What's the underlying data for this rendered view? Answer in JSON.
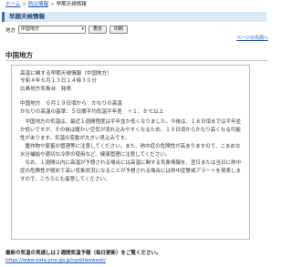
{
  "breadcrumb": {
    "home": "ホーム",
    "sep1": ">",
    "disaster": "防災情報",
    "sep2": ">",
    "current": "早期天候情報"
  },
  "page_title": "早期天候情報",
  "region": {
    "label": "地方",
    "selected": "中国地方",
    "show_button": "表示",
    "print_button": "印刷"
  },
  "top_link": "ページの先頭へ",
  "section_title": "中国地方",
  "report": {
    "heading": "高温に関する早期天候情報（中国地方）",
    "datetime": "令和４年６月１３日１４時３０分",
    "issuer": "広島地方気象台　発表",
    "summary_line1": "中国地方　６月１９日頃から　かなりの高温",
    "summary_line2": "かなりの高温の基準：５日間平均気温平年差　＋１．８℃以上",
    "body": "　中国地方の気温は、最近１週間程度は平年並か低くなりました。今後は、１８日頃までは平年並か低いですが、その後は暖かい空気が流れ込みやすくなるため、１９日頃からかなり高くなる可能性があります。気温の変動が大きい見込みです。\n　農作物や家畜の管理等に注意してください。また、熱中症の危険性が高まりますので、こまめな水分補給や適切な冷房の使用など、健康管理に注意してください。\n　なお、１週間以内に高温が予想される場合には高温に関する気象情報を、翌日または当日に熱中症の危険性が極めて高い気象状況になることが予想される場合には熱中症警戒アラートを発表しますので、こちらにも留意してください。"
  },
  "footer": {
    "title": "最新の気温の見通しは２週間気温予報（毎日更新）をご覧ください。",
    "link": "https://www.data.jma.go.jp/cpd/twoweek/"
  }
}
